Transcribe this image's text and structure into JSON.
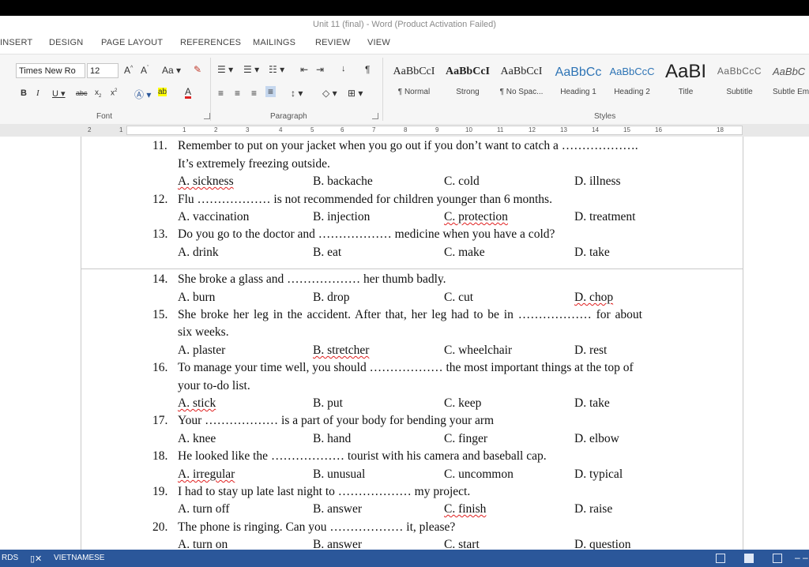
{
  "window": {
    "title": "Unit 11 (final) - Word (Product Activation Failed)"
  },
  "tabs": [
    "INSERT",
    "DESIGN",
    "PAGE LAYOUT",
    "REFERENCES",
    "MAILINGS",
    "REVIEW",
    "VIEW"
  ],
  "ribbon": {
    "font": {
      "name": "Times New Ro",
      "size": "12",
      "group_label": "Font"
    },
    "paragraph": {
      "group_label": "Paragraph"
    },
    "styles": {
      "group_label": "Styles",
      "items": [
        {
          "sample": "AaBbCcI",
          "name": "¶ Normal"
        },
        {
          "sample": "AaBbCcI",
          "name": "Strong"
        },
        {
          "sample": "AaBbCcI",
          "name": "¶ No Spac..."
        },
        {
          "sample": "AaBbCc",
          "name": "Heading 1"
        },
        {
          "sample": "AaBbCcC",
          "name": "Heading 2"
        },
        {
          "sample": "AaBI",
          "name": "Title"
        },
        {
          "sample": "AaBbCcC",
          "name": "Subtitle"
        },
        {
          "sample": "AaBbC",
          "name": "Subtle Em"
        }
      ]
    }
  },
  "ruler": {
    "numbers": [
      "2",
      "1",
      "1",
      "2",
      "3",
      "4",
      "5",
      "6",
      "7",
      "8",
      "9",
      "10",
      "11",
      "12",
      "13",
      "14",
      "15",
      "16",
      "18"
    ]
  },
  "document": {
    "q11": {
      "num": "11.",
      "text": "Remember to put on your jacket when you go out if you don’t want to catch a ……………….",
      "cont": "It’s extremely freezing outside.",
      "a": "A. sickness",
      "b": "B. backache",
      "c": "C. cold",
      "d": "D. illness"
    },
    "q12": {
      "num": "12.",
      "text": "Flu ……………… is not recommended for children younger than 6 months.",
      "a": "A. vaccination",
      "b": "B. injection",
      "c": "C. protection",
      "d": "D. treatment"
    },
    "q13": {
      "num": "13.",
      "text": "Do you go to the doctor and ……………… medicine when you have a cold?",
      "a": "A. drink",
      "b": "B. eat",
      "c": "C. make",
      "d": "D. take"
    },
    "q14": {
      "num": "14.",
      "text": "She broke a glass and ……………… her thumb badly.",
      "a": "A. burn",
      "b": "B. drop",
      "c": "C. cut",
      "d": "D. chop"
    },
    "q15": {
      "num": "15.",
      "text": "She broke her leg in the accident. After that, her leg had to be in ……………… for about",
      "cont": "six weeks.",
      "a": "A. plaster",
      "b": "B. stretcher",
      "c": "C. wheelchair",
      "d": "D. rest"
    },
    "q16": {
      "num": "16.",
      "text": "To manage your time well, you should ……………… the most important things at the top of",
      "cont": "your to-do list.",
      "a": "A. stick",
      "b": "B. put",
      "c": "C. keep",
      "d": "D. take"
    },
    "q17": {
      "num": "17.",
      "text": "Your ……………… is a part of your body for bending your arm",
      "a": "A. knee",
      "b": "B. hand",
      "c": "C. finger",
      "d": "D. elbow"
    },
    "q18": {
      "num": "18.",
      "text": "He looked like the ……………… tourist with his camera and baseball cap.",
      "a": "A. irregular",
      "b": "B. unusual",
      "c": "C. uncommon",
      "d": "D. typical"
    },
    "q19": {
      "num": "19.",
      "text": "I had to stay up late last night to ……………… my project.",
      "a": "A. turn off",
      "b": "B. answer",
      "c": "C. finish",
      "d": "D. raise"
    },
    "q20": {
      "num": "20.",
      "text": "The phone is ringing. Can you ……………… it, please?",
      "a": "A. turn on",
      "b": "B. answer",
      "c": "C. start",
      "d": "D. question"
    }
  },
  "statusbar": {
    "words": "RDS",
    "language": "VIETNAMESE",
    "color": "#2b579a"
  }
}
